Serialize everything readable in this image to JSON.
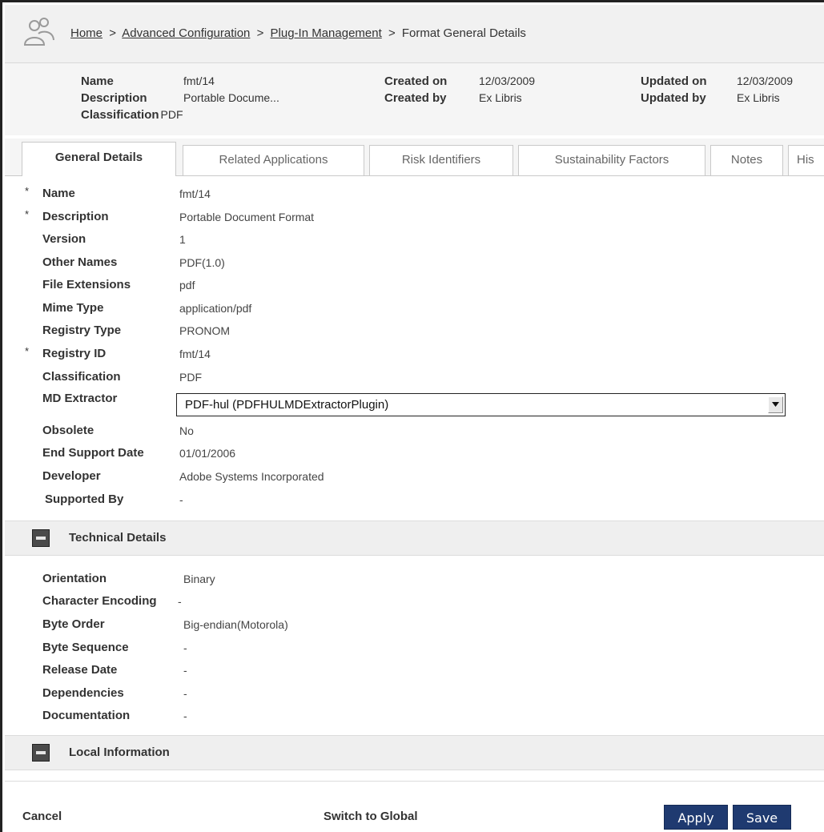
{
  "breadcrumb": {
    "home": "Home",
    "advanced": "Advanced Configuration",
    "plugin": "Plug-In Management",
    "current": "Format General Details",
    "separator": ">"
  },
  "summary": {
    "name_label": "Name",
    "name_value": "fmt/14",
    "description_label": "Description",
    "description_value": "Portable Docume...",
    "classification_label": "Classification",
    "classification_value": "PDF",
    "created_on_label": "Created on",
    "created_on_value": "12/03/2009",
    "created_by_label": "Created by",
    "created_by_value": "Ex Libris",
    "updated_on_label": "Updated on",
    "updated_on_value": "12/03/2009",
    "updated_by_label": "Updated by",
    "updated_by_value": "Ex Libris"
  },
  "tabs": [
    {
      "label": "General Details",
      "active": true
    },
    {
      "label": "Related Applications"
    },
    {
      "label": "Risk Identifiers"
    },
    {
      "label": "Sustainability Factors"
    },
    {
      "label": "Notes"
    },
    {
      "label": "His"
    }
  ],
  "general": {
    "required_marker": "*",
    "fields": [
      {
        "label": "Name",
        "value": "fmt/14",
        "required": true
      },
      {
        "label": "Description",
        "value": "Portable Document Format",
        "required": true
      },
      {
        "label": "Version",
        "value": "1"
      },
      {
        "label": "Other Names",
        "value": "PDF(1.0)"
      },
      {
        "label": "File Extensions",
        "value": "pdf"
      },
      {
        "label": "Mime Type",
        "value": "application/pdf"
      },
      {
        "label": "Registry Type",
        "value": "PRONOM"
      },
      {
        "label": "Registry ID",
        "value": "fmt/14",
        "required": true
      },
      {
        "label": "Classification",
        "value": "PDF"
      },
      {
        "label": "MD Extractor",
        "value": "PDF-hul (PDFHULMDExtractorPlugin)"
      },
      {
        "label": "Obsolete",
        "value": "No"
      },
      {
        "label": "End Support Date",
        "value": "01/01/2006"
      },
      {
        "label": "Developer",
        "value": "Adobe Systems Incorporated"
      },
      {
        "label": "Supported By",
        "value": "-"
      }
    ]
  },
  "technical": {
    "title": "Technical Details",
    "fields": [
      {
        "label": "Orientation",
        "value": "Binary"
      },
      {
        "label": "Character Encoding",
        "value": "-"
      },
      {
        "label": "Byte Order",
        "value": "Big-endian(Motorola)"
      },
      {
        "label": "Byte Sequence",
        "value": "-"
      },
      {
        "label": "Release Date",
        "value": "-"
      },
      {
        "label": "Dependencies",
        "value": "-"
      },
      {
        "label": "Documentation",
        "value": "-"
      }
    ]
  },
  "local": {
    "title": "Local Information"
  },
  "footer": {
    "cancel": "Cancel",
    "switch": "Switch to Global",
    "apply": "Apply",
    "save": "Save"
  },
  "colors": {
    "primary_button": "#1f3a70",
    "section_bg": "#efefef"
  }
}
